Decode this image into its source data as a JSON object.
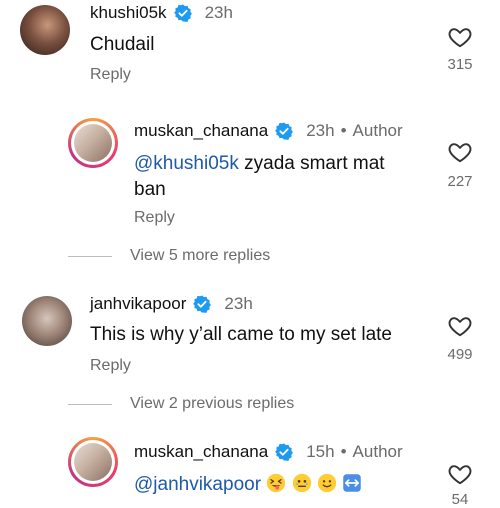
{
  "comments": [
    {
      "username": "khushi05k",
      "time": "23h",
      "text": "Chudail",
      "reply_label": "Reply",
      "likes": "315"
    },
    {
      "username": "muskan_chanana",
      "time": "23h",
      "author_label": "Author",
      "mention": "@khushi05k",
      "text": " zyada smart mat ban",
      "reply_label": "Reply",
      "likes": "227"
    },
    {
      "view_more": "View 5 more replies"
    },
    {
      "username": "janhvikapoor",
      "time": "23h",
      "text": "This is why y’all came to my set late",
      "reply_label": "Reply",
      "likes": "499"
    },
    {
      "view_prev": "View 2 previous replies"
    },
    {
      "username": "muskan_chanana",
      "time": "15h",
      "author_label": "Author",
      "mention": "@janhvikapoor",
      "likes": "54"
    }
  ],
  "icons": {
    "verified": "verified-badge-icon",
    "like": "heart-outline-icon",
    "emoji_1": "squinting-tongue-face-emoji",
    "emoji_2": "face-holding-back-tears-emoji",
    "emoji_3": "slightly-smiling-face-emoji",
    "emoji_4": "left-right-arrow-emoji"
  },
  "colors": {
    "verified": "#1d9bf0",
    "mention": "#1e5aa8",
    "secondary_text": "#6b6b6b"
  }
}
